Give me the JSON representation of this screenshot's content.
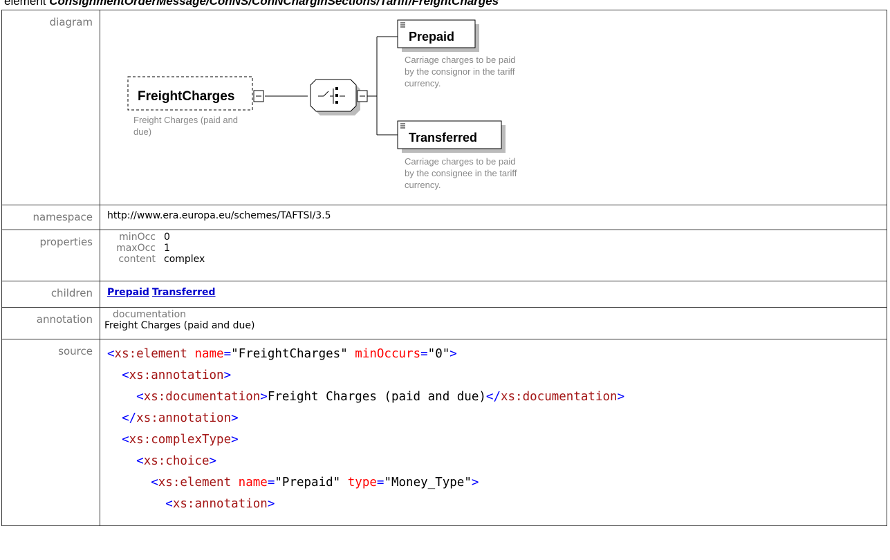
{
  "title": {
    "prefix": "element ",
    "path": "ConsignmentOrderMessage/ConNS/ConNCharginSections/Tariff/FreightCharges"
  },
  "rows": {
    "diagram_label": "diagram",
    "namespace_label": "namespace",
    "properties_label": "properties",
    "children_label": "children",
    "annotation_label": "annotation",
    "source_label": "source"
  },
  "diagram": {
    "root": {
      "name": "FreightCharges",
      "doc_line1": "Freight Charges (paid and",
      "doc_line2": "due)"
    },
    "prepaid": {
      "name": "Prepaid",
      "doc_line1": "Carriage charges to be paid",
      "doc_line2": "by the consignor in the tariff",
      "doc_line3": "currency."
    },
    "transferred": {
      "name": "Transferred",
      "doc_line1": "Carriage charges to be paid",
      "doc_line2": "by the consignee in the tariff",
      "doc_line3": "currency."
    }
  },
  "namespace": "http://www.era.europa.eu/schemes/TAFTSI/3.5",
  "properties": [
    {
      "key": "minOcc",
      "value": "0"
    },
    {
      "key": "maxOcc",
      "value": "1"
    },
    {
      "key": "content",
      "value": "complex"
    }
  ],
  "children": [
    "Prepaid",
    "Transferred"
  ],
  "annotation": {
    "key": "documentation",
    "value": "Freight Charges (paid and due)"
  },
  "source": {
    "l1": {
      "open": "<",
      "tag": "xs:element",
      "a1": "name",
      "v1": "\"FreightCharges\"",
      "a2": "minOccurs",
      "v2": "\"0\"",
      "close": ">"
    },
    "l2": {
      "open": "<",
      "tag": "xs:annotation",
      "close": ">"
    },
    "l3": {
      "open": "<",
      "tag": "xs:documentation",
      "close": ">",
      "text": "Freight Charges (paid and due)",
      "open2": "</",
      "tag2": "xs:documentation",
      "close2": ">"
    },
    "l4": {
      "open": "</",
      "tag": "xs:annotation",
      "close": ">"
    },
    "l5": {
      "open": "<",
      "tag": "xs:complexType",
      "close": ">"
    },
    "l6": {
      "open": "<",
      "tag": "xs:choice",
      "close": ">"
    },
    "l7": {
      "open": "<",
      "tag": "xs:element",
      "a1": "name",
      "v1": "\"Prepaid\"",
      "a2": "type",
      "v2": "\"Money_Type\"",
      "close": ">"
    },
    "l8": {
      "open": "<",
      "tag": "xs:annotation",
      "close": ">"
    }
  }
}
